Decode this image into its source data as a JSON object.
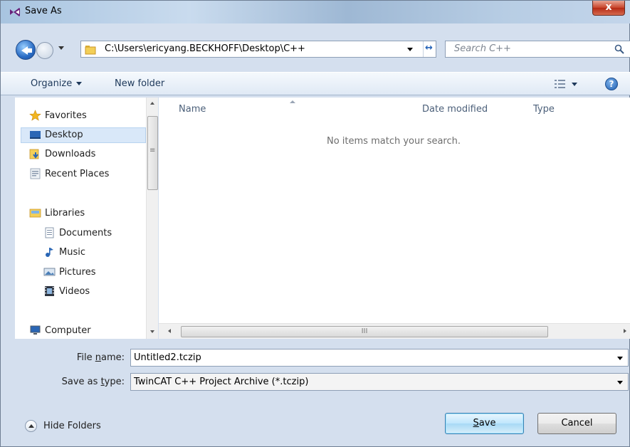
{
  "window": {
    "title": "Save As",
    "close_label": "x"
  },
  "address": {
    "path": "C:\\Users\\ericyang.BECKHOFF\\Desktop\\C++",
    "refresh_glyph": "↔"
  },
  "search": {
    "placeholder": "Search C++"
  },
  "toolbar": {
    "organize_label": "Organize",
    "new_folder_label": "New folder",
    "help_label": "?"
  },
  "nav": {
    "favorites_label": "Favorites",
    "desktop_label": "Desktop",
    "downloads_label": "Downloads",
    "recent_places_label": "Recent Places",
    "libraries_label": "Libraries",
    "documents_label": "Documents",
    "music_label": "Music",
    "pictures_label": "Pictures",
    "videos_label": "Videos",
    "computer_label": "Computer",
    "selected": "Desktop"
  },
  "filelist": {
    "columns": [
      "Name",
      "Date modified",
      "Type"
    ],
    "empty_message": "No items match your search.",
    "hscroll_grip": "III"
  },
  "form": {
    "file_name_label_pre": "File ",
    "file_name_label_ul": "n",
    "file_name_label_post": "ame:",
    "file_name_value": "Untitled2.tczip",
    "save_type_label_pre": "Save as ",
    "save_type_label_ul": "t",
    "save_type_label_post": "ype:",
    "save_type_value": "TwinCAT C++ Project Archive (*.tczip)"
  },
  "footer": {
    "hide_folders_label": "Hide Folders",
    "save_ul": "S",
    "save_rest": "ave",
    "cancel_label": "Cancel"
  },
  "colors": {
    "accent": "#3c7fb1",
    "toolbar_text": "#1e395b",
    "selection": "#d9e8f9"
  }
}
